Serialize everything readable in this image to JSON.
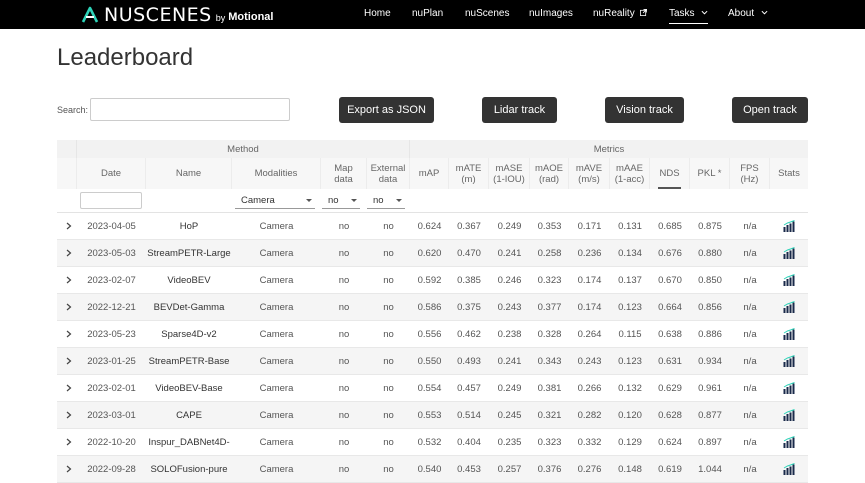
{
  "nav": {
    "logo_text": "NUSCENES",
    "logo_by": "by",
    "logo_brand": "Motional",
    "links": [
      {
        "label": "Home"
      },
      {
        "label": "nuPlan"
      },
      {
        "label": "nuScenes"
      },
      {
        "label": "nuImages"
      },
      {
        "label": "nuReality",
        "icon": "external-link-icon"
      },
      {
        "label": "Tasks",
        "icon": "chevron-down-icon",
        "active": true
      },
      {
        "label": "About",
        "icon": "chevron-down-icon"
      }
    ]
  },
  "page": {
    "title": "Leaderboard",
    "search_label": "Search:",
    "search_value": "",
    "search_placeholder": ""
  },
  "buttons": {
    "export": "Export as JSON",
    "lidar": "Lidar track",
    "vision": "Vision track",
    "open": "Open track"
  },
  "table": {
    "groups": {
      "method": "Method",
      "metrics": "Metrics"
    },
    "headers": {
      "date": "Date",
      "name": "Name",
      "modalities": "Modalities",
      "map_data": "Map\ndata",
      "external_data": "External\ndata",
      "map": "mAP",
      "mate": "mATE\n(m)",
      "mase": "mASE\n(1-IOU)",
      "maoe": "mAOE\n(rad)",
      "mave": "mAVE\n(m/s)",
      "maae": "mAAE\n(1-acc)",
      "nds": "NDS",
      "pkl": "PKL *",
      "fps": "FPS (Hz)",
      "stats": "Stats"
    },
    "filters": {
      "modalities": "Camera",
      "map_data": "no",
      "external_data": "no",
      "date_value": ""
    },
    "rows": [
      {
        "date": "2023-04-05",
        "name": "HoP",
        "modalities": "Camera",
        "map_data": "no",
        "external_data": "no",
        "map": "0.624",
        "mate": "0.367",
        "mase": "0.249",
        "maoe": "0.353",
        "mave": "0.171",
        "maae": "0.131",
        "nds": "0.685",
        "pkl": "0.875",
        "fps": "n/a"
      },
      {
        "date": "2023-05-03",
        "name": "StreamPETR-Large",
        "modalities": "Camera",
        "map_data": "no",
        "external_data": "no",
        "map": "0.620",
        "mate": "0.470",
        "mase": "0.241",
        "maoe": "0.258",
        "mave": "0.236",
        "maae": "0.134",
        "nds": "0.676",
        "pkl": "0.880",
        "fps": "n/a"
      },
      {
        "date": "2023-02-07",
        "name": "VideoBEV",
        "modalities": "Camera",
        "map_data": "no",
        "external_data": "no",
        "map": "0.592",
        "mate": "0.385",
        "mase": "0.246",
        "maoe": "0.323",
        "mave": "0.174",
        "maae": "0.137",
        "nds": "0.670",
        "pkl": "0.850",
        "fps": "n/a"
      },
      {
        "date": "2022-12-21",
        "name": "BEVDet-Gamma",
        "modalities": "Camera",
        "map_data": "no",
        "external_data": "no",
        "map": "0.586",
        "mate": "0.375",
        "mase": "0.243",
        "maoe": "0.377",
        "mave": "0.174",
        "maae": "0.123",
        "nds": "0.664",
        "pkl": "0.856",
        "fps": "n/a"
      },
      {
        "date": "2023-05-23",
        "name": "Sparse4D-v2",
        "modalities": "Camera",
        "map_data": "no",
        "external_data": "no",
        "map": "0.556",
        "mate": "0.462",
        "mase": "0.238",
        "maoe": "0.328",
        "mave": "0.264",
        "maae": "0.115",
        "nds": "0.638",
        "pkl": "0.886",
        "fps": "n/a"
      },
      {
        "date": "2023-01-25",
        "name": "StreamPETR-Base",
        "modalities": "Camera",
        "map_data": "no",
        "external_data": "no",
        "map": "0.550",
        "mate": "0.493",
        "mase": "0.241",
        "maoe": "0.343",
        "mave": "0.243",
        "maae": "0.123",
        "nds": "0.631",
        "pkl": "0.934",
        "fps": "n/a"
      },
      {
        "date": "2023-02-01",
        "name": "VideoBEV-Base",
        "modalities": "Camera",
        "map_data": "no",
        "external_data": "no",
        "map": "0.554",
        "mate": "0.457",
        "mase": "0.249",
        "maoe": "0.381",
        "mave": "0.266",
        "maae": "0.132",
        "nds": "0.629",
        "pkl": "0.961",
        "fps": "n/a"
      },
      {
        "date": "2023-03-01",
        "name": "CAPE",
        "modalities": "Camera",
        "map_data": "no",
        "external_data": "no",
        "map": "0.553",
        "mate": "0.514",
        "mase": "0.245",
        "maoe": "0.321",
        "mave": "0.282",
        "maae": "0.120",
        "nds": "0.628",
        "pkl": "0.877",
        "fps": "n/a"
      },
      {
        "date": "2022-10-20",
        "name": "Inspur_DABNet4D-",
        "modalities": "Camera",
        "map_data": "no",
        "external_data": "no",
        "map": "0.532",
        "mate": "0.404",
        "mase": "0.235",
        "maoe": "0.323",
        "mave": "0.332",
        "maae": "0.129",
        "nds": "0.624",
        "pkl": "0.897",
        "fps": "n/a"
      },
      {
        "date": "2022-09-28",
        "name": "SOLOFusion-pure",
        "modalities": "Camera",
        "map_data": "no",
        "external_data": "no",
        "map": "0.540",
        "mate": "0.453",
        "mase": "0.257",
        "maoe": "0.376",
        "mave": "0.276",
        "maae": "0.148",
        "nds": "0.619",
        "pkl": "1.044",
        "fps": "n/a"
      }
    ]
  },
  "colors": {
    "navbar": "#000000",
    "button": "#333333",
    "logo_accent": "#2dd3b8"
  }
}
